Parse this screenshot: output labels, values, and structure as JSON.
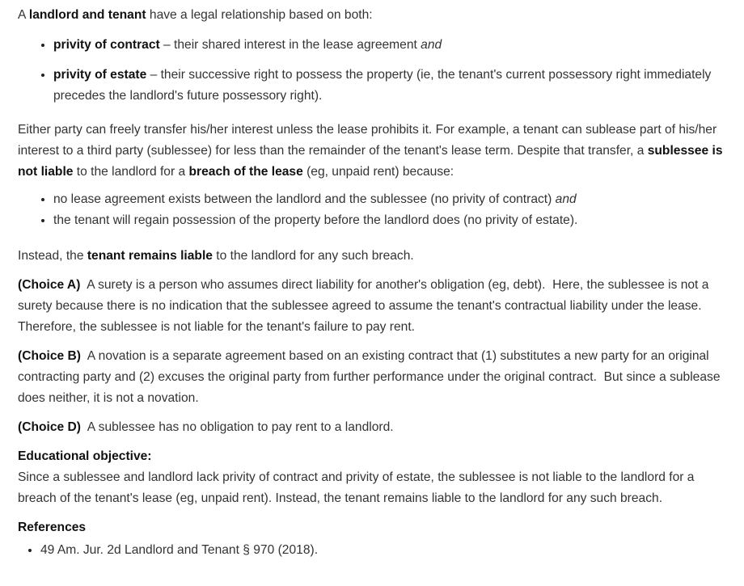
{
  "intro": {
    "pre": "A ",
    "bold": "landlord and tenant",
    "post": " have a legal relationship based on both:"
  },
  "privity_list": [
    {
      "bold": "privity of contract",
      "text": " – their shared interest in the lease agreement ",
      "italic": "and"
    },
    {
      "bold": "privity of estate",
      "text": " – their successive right to possess the property (ie, the tenant's current possessory right immediately precedes the landlord's future possessory right)."
    }
  ],
  "transfer": {
    "text1": "Either party can freely transfer his/her interest unless the lease prohibits it.  For example, a tenant can sublease part of his/her interest to a third party (sublessee) for less than the remainder of the tenant's lease term.  Despite that transfer, a ",
    "bold1": "sublessee is not liable",
    "text2": " to the landlord for a ",
    "bold2": "breach of the lease",
    "text3": " (eg, unpaid rent) because:"
  },
  "reasons_list": [
    {
      "text": "no lease agreement exists between the landlord and the sublessee (no privity of contract) ",
      "italic": "and"
    },
    {
      "text": "the tenant will regain possession of the property before the landlord does (no privity of estate)."
    }
  ],
  "instead": {
    "pre": "Instead, the ",
    "bold": "tenant remains liable",
    "post": " to the landlord for any such breach."
  },
  "choices": [
    {
      "label": "(Choice A)",
      "text": "  A surety is a person who assumes direct liability for another's obligation (eg, debt).  Here, the sublessee is not a surety because there is no indication that the sublessee agreed to assume the tenant's contractual liability under the lease.  Therefore, the sublessee is not liable for the tenant's failure to pay rent."
    },
    {
      "label": "(Choice B)",
      "text": "  A novation is a separate agreement based on an existing contract that (1) substitutes a new party for an original contracting party and (2) excuses the original party from further performance under the original contract.  But since a sublease does neither, it is not a novation."
    },
    {
      "label": "(Choice D)",
      "text": "  A sublessee has no obligation to pay rent to a landlord."
    }
  ],
  "objective": {
    "heading": "Educational objective:",
    "text": "Since a sublessee and landlord lack privity of contract and privity of estate, the sublessee is not liable to the landlord for a breach of the tenant's lease (eg, unpaid rent).  Instead, the tenant remains liable to the landlord for any such breach."
  },
  "references": {
    "heading": "References",
    "items": [
      "49 Am. Jur. 2d Landlord and Tenant § 970 (2018)."
    ]
  }
}
